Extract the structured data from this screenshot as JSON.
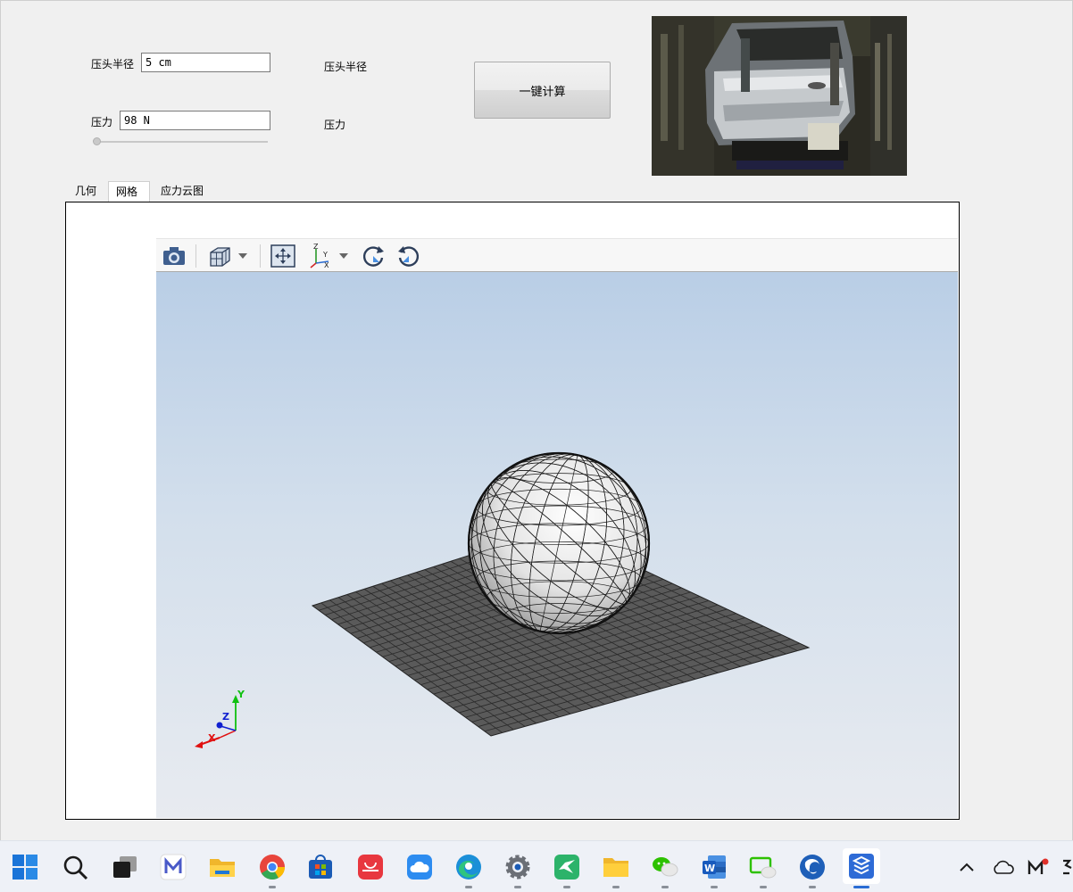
{
  "form": {
    "radius_label": "压头半径",
    "radius_value": "5 cm",
    "radius_display": "压头半径",
    "force_label": "压力",
    "force_value": "98 N",
    "force_display": "压力",
    "force_slider_level": 0,
    "calc_button": "一键计算"
  },
  "tabs": [
    {
      "label": "几何",
      "active": false
    },
    {
      "label": "网格",
      "active": true
    },
    {
      "label": "应力云图",
      "active": false
    }
  ],
  "viewer_toolbar": {
    "items": [
      "camera-icon",
      "view-cube-icon",
      "dropdown-arrow-icon",
      "fit-view-icon",
      "axes-orientation-icon",
      "dropdown-arrow-icon",
      "rotate-clockwise-icon",
      "rotate-counterclockwise-icon"
    ]
  },
  "axes": {
    "x": "X",
    "y": "Y",
    "z": "Z"
  },
  "colors": {
    "window_bg": "#f0f0f0",
    "viewport_top": "#b9cee6",
    "viewport_bottom": "#e8ebf0",
    "plate": "#5a5a5a",
    "sphere": "#e8e8e8",
    "axis_x": "#e01010",
    "axis_y": "#10c010",
    "axis_z": "#1020d0",
    "taskbar_active": "#2a6cd3"
  },
  "taskbar": {
    "apps": [
      "windows-start-icon",
      "search-icon",
      "task-view-icon",
      "mindmaster-icon",
      "file-explorer-icon",
      "chrome-icon",
      "microsoft-store-icon",
      "huawei-appgallery-icon",
      "cloud-drive-icon",
      "edge-icon",
      "settings-icon",
      "swift-pdf-icon",
      "folder-icon",
      "wechat-icon",
      "word-icon",
      "wechat-desktop-icon",
      "browser-swirl-icon",
      "fem-app-icon"
    ],
    "tray": [
      "chevron-up-icon",
      "onedrive-cloud-icon",
      "mindmaster-tray-icon",
      "tray-misc-icon"
    ]
  }
}
